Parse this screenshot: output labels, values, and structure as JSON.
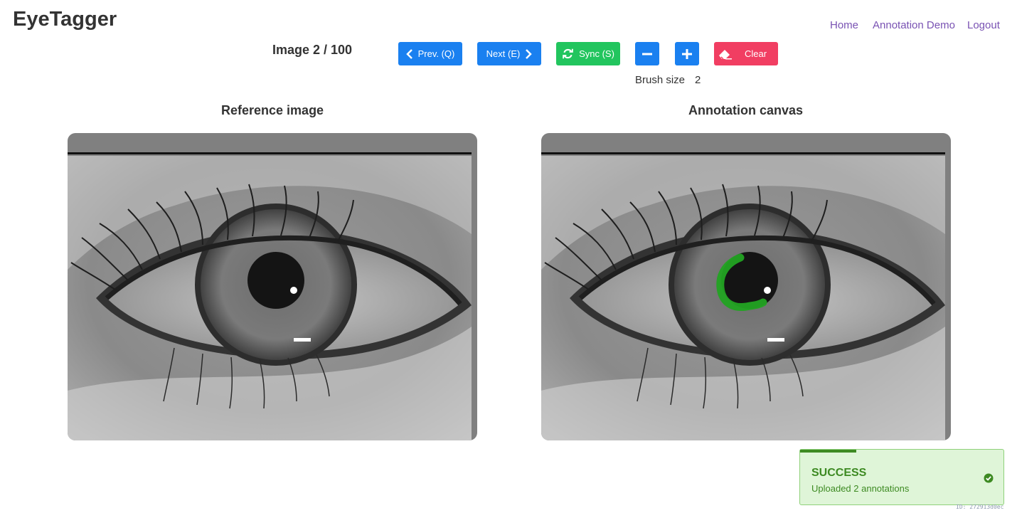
{
  "app": {
    "title": "EyeTagger"
  },
  "nav": {
    "home": "Home",
    "demo": "Annotation Demo",
    "logout": "Logout"
  },
  "toolbar": {
    "counter": "Image 2 / 100",
    "prev_label": "Prev. (Q)",
    "next_label": "Next (E)",
    "sync_label": "Sync (S)",
    "clear_label": "Clear",
    "brush_label": "Brush size",
    "brush_value": "2",
    "icons": [
      "chevron-left-icon",
      "chevron-right-icon",
      "sync-icon",
      "minus-icon",
      "plus-icon",
      "eraser-icon"
    ]
  },
  "panels": {
    "reference_title": "Reference image",
    "annotation_title": "Annotation canvas",
    "annotation_color": "#22a322"
  },
  "toast": {
    "title": "SUCCESS",
    "message": "Uploaded 2 annotations",
    "color": "#3d8a22"
  },
  "footer": {
    "id": "ID: 272913d0ec"
  },
  "colors": {
    "accent": "#1a80f0",
    "sync": "#22c55e",
    "clear": "#f13e62",
    "link": "#7952b3"
  }
}
